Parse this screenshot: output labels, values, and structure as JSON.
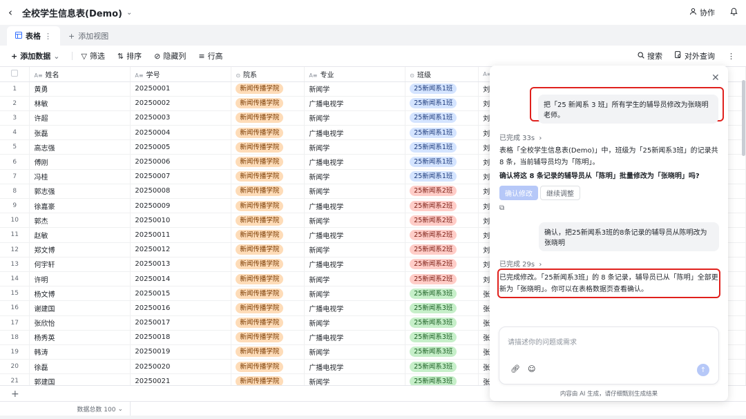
{
  "topbar": {
    "title": "全校学生信息表(Demo)",
    "collab_label": "协作"
  },
  "tabs": {
    "active_label": "表格",
    "add_view_label": "添加视图"
  },
  "toolbar": {
    "add_data": "添加数据",
    "filter": "筛选",
    "sort": "排序",
    "hide_cols": "隐藏列",
    "row_height": "行高",
    "search": "搜索",
    "external_query": "对外查询"
  },
  "columns": [
    "姓名",
    "学号",
    "院系",
    "专业",
    "班级"
  ],
  "rows": [
    {
      "n": "1",
      "name": "黄勇",
      "id": "20250001",
      "dept": "新闻传播学院",
      "major": "新闻学",
      "cls": "25新闻系1班",
      "c": "cls1",
      "t": "刘"
    },
    {
      "n": "2",
      "name": "林敏",
      "id": "20250002",
      "dept": "新闻传播学院",
      "major": "广播电视学",
      "cls": "25新闻系1班",
      "c": "cls1",
      "t": "刘"
    },
    {
      "n": "3",
      "name": "许超",
      "id": "20250003",
      "dept": "新闻传播学院",
      "major": "新闻学",
      "cls": "25新闻系1班",
      "c": "cls1",
      "t": "刘"
    },
    {
      "n": "4",
      "name": "张磊",
      "id": "20250004",
      "dept": "新闻传播学院",
      "major": "广播电视学",
      "cls": "25新闻系1班",
      "c": "cls1",
      "t": "刘"
    },
    {
      "n": "5",
      "name": "高志强",
      "id": "20250005",
      "dept": "新闻传播学院",
      "major": "新闻学",
      "cls": "25新闻系1班",
      "c": "cls1",
      "t": "刘"
    },
    {
      "n": "6",
      "name": "傅刚",
      "id": "20250006",
      "dept": "新闻传播学院",
      "major": "广播电视学",
      "cls": "25新闻系1班",
      "c": "cls1",
      "t": "刘"
    },
    {
      "n": "7",
      "name": "冯桂",
      "id": "20250007",
      "dept": "新闻传播学院",
      "major": "新闻学",
      "cls": "25新闻系1班",
      "c": "cls1",
      "t": "刘"
    },
    {
      "n": "8",
      "name": "郭志强",
      "id": "20250008",
      "dept": "新闻传播学院",
      "major": "新闻学",
      "cls": "25新闻系2班",
      "c": "cls2",
      "t": "刘"
    },
    {
      "n": "9",
      "name": "徐嘉豪",
      "id": "20250009",
      "dept": "新闻传播学院",
      "major": "广播电视学",
      "cls": "25新闻系2班",
      "c": "cls2",
      "t": "刘"
    },
    {
      "n": "10",
      "name": "郭杰",
      "id": "20250010",
      "dept": "新闻传播学院",
      "major": "新闻学",
      "cls": "25新闻系2班",
      "c": "cls2",
      "t": "刘"
    },
    {
      "n": "11",
      "name": "赵敏",
      "id": "20250011",
      "dept": "新闻传播学院",
      "major": "广播电视学",
      "cls": "25新闻系2班",
      "c": "cls2",
      "t": "刘"
    },
    {
      "n": "12",
      "name": "郑文博",
      "id": "20250012",
      "dept": "新闻传播学院",
      "major": "新闻学",
      "cls": "25新闻系2班",
      "c": "cls2",
      "t": "刘"
    },
    {
      "n": "13",
      "name": "何宇轩",
      "id": "20250013",
      "dept": "新闻传播学院",
      "major": "广播电视学",
      "cls": "25新闻系2班",
      "c": "cls2",
      "t": "刘"
    },
    {
      "n": "14",
      "name": "许明",
      "id": "20250014",
      "dept": "新闻传播学院",
      "major": "新闻学",
      "cls": "25新闻系2班",
      "c": "cls2",
      "t": "刘"
    },
    {
      "n": "15",
      "name": "杨文博",
      "id": "20250015",
      "dept": "新闻传播学院",
      "major": "新闻学",
      "cls": "25新闻系3班",
      "c": "cls3",
      "t": "张"
    },
    {
      "n": "16",
      "name": "谢建国",
      "id": "20250016",
      "dept": "新闻传播学院",
      "major": "广播电视学",
      "cls": "25新闻系3班",
      "c": "cls3",
      "t": "张"
    },
    {
      "n": "17",
      "name": "张欣怡",
      "id": "20250017",
      "dept": "新闻传播学院",
      "major": "新闻学",
      "cls": "25新闻系3班",
      "c": "cls3",
      "t": "张"
    },
    {
      "n": "18",
      "name": "杨秀英",
      "id": "20250018",
      "dept": "新闻传播学院",
      "major": "广播电视学",
      "cls": "25新闻系3班",
      "c": "cls3",
      "t": "张"
    },
    {
      "n": "19",
      "name": "韩涛",
      "id": "20250019",
      "dept": "新闻传播学院",
      "major": "新闻学",
      "cls": "25新闻系3班",
      "c": "cls3",
      "t": "张"
    },
    {
      "n": "20",
      "name": "徐磊",
      "id": "20250020",
      "dept": "新闻传播学院",
      "major": "广播电视学",
      "cls": "25新闻系3班",
      "c": "cls3",
      "t": "张"
    },
    {
      "n": "21",
      "name": "郭建国",
      "id": "20250021",
      "dept": "新闻传播学院",
      "major": "新闻学",
      "cls": "25新闻系3班",
      "c": "cls3",
      "t": "张"
    }
  ],
  "footer": {
    "count_label": "数据总数 100"
  },
  "chat": {
    "user_msg_1": "把「25 新闻系 3 班」所有学生的辅导员修改为张晓明老师。",
    "done_1": "已完成 33s",
    "answer_1": "表格「全校学生信息表(Demo)」中，班级为「25新闻系3班」的记录共 8 条，当前辅导员均为「陈明」。",
    "question_1": "确认将这 8 条记录的辅导员从「陈明」批量修改为「张晓明」吗?",
    "confirm_btn": "确认修改",
    "adjust_btn": "继续调整",
    "user_msg_2": "确认，把25新闻系3班的8条记录的辅导员从陈明改为张晓明",
    "done_2": "已完成 29s",
    "answer_2": "已完成修改。「25新闻系3班」的 8 条记录，辅导员已从「陈明」全部更新为「张晓明」。你可以在表格数据页查看确认。",
    "input_placeholder": "请描述你的问题或需求",
    "disclaimer": "内容由 AI 生成，请仔细甄别生成结果"
  },
  "colors": {
    "highlight": "#e0201c",
    "accent": "#3370ff"
  }
}
